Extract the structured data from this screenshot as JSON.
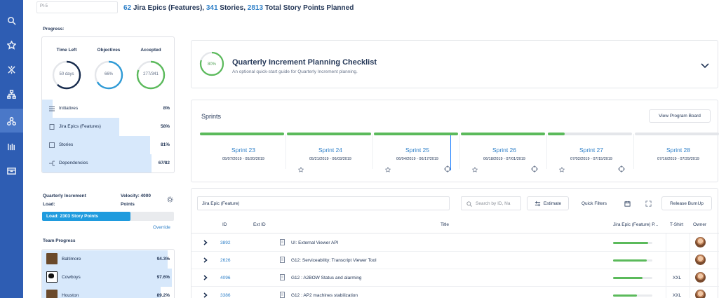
{
  "nav": {
    "icons": [
      "search-icon",
      "star-icon",
      "crosshair-icon",
      "hierarchy-icon",
      "program-icon",
      "roadmap-icon",
      "board-icon"
    ]
  },
  "header": {
    "pi_value": "PI-5",
    "epics_count": "62",
    "epics_label": " Jira Epics (Features), ",
    "stories_count": "341",
    "stories_label": " Stories, ",
    "points_count": "2813",
    "points_label": " Total Story Points Planned"
  },
  "progress": {
    "label": "Progress:",
    "metrics": [
      {
        "title": "Time Left",
        "value": "50 days",
        "fraction": 0.62,
        "color": "#172b4d"
      },
      {
        "title": "Objectives",
        "value": "66%",
        "fraction": 0.66,
        "color": "#2f9bd6"
      },
      {
        "title": "Accepted",
        "value": "277/341",
        "fraction": 0.81,
        "color": "#5bba5b"
      }
    ],
    "rows": [
      {
        "label": "Initiatives",
        "pct": "8%",
        "fraction": 0.08
      },
      {
        "label": "Jira Epics (Features)",
        "pct": "58%",
        "fraction": 0.58
      },
      {
        "label": "Stories",
        "pct": "81%",
        "fraction": 0.81
      },
      {
        "label": "Dependencies",
        "pct": "67/82",
        "fraction": 0.82
      }
    ]
  },
  "load": {
    "label": "Quarterly Increment Load:",
    "velocity": "Velocity: 4000 Points",
    "bar_text": "Load: 2303 Story Points",
    "fraction": 0.67,
    "override": "Override"
  },
  "team": {
    "label": "Team Progress",
    "rows": [
      {
        "name": "Baltimore",
        "pct": "94.3%",
        "fraction": 0.943
      },
      {
        "name": "Cowboys",
        "pct": "97.6%",
        "fraction": 0.976
      },
      {
        "name": "Houston",
        "pct": "89.2%",
        "fraction": 0.892
      }
    ]
  },
  "checklist": {
    "pct": "80%",
    "fraction": 0.8,
    "title": "Quarterly Increment Planning Checklist",
    "subtitle": "An optional quick-start guide for Quarterly Increment planning."
  },
  "sprints": {
    "title": "Sprints",
    "board_button": "View Program Board",
    "items": [
      {
        "name": "Sprint 23",
        "dates": "05/07/2019 - 05/20/2019",
        "fraction": 1.0,
        "has_target": false
      },
      {
        "name": "Sprint 24",
        "dates": "05/21/2019 - 06/03/2019",
        "fraction": 1.0,
        "has_target": false
      },
      {
        "name": "Sprint 25",
        "dates": "06/04/2019 - 06/17/2019",
        "fraction": 1.0,
        "has_target": true
      },
      {
        "name": "Sprint 26",
        "dates": "06/18/2019 - 07/01/2019",
        "fraction": 1.0,
        "has_target": true
      },
      {
        "name": "Sprint 27",
        "dates": "07/02/2019 - 07/15/2019",
        "fraction": 0.2,
        "has_target": true
      },
      {
        "name": "Sprint 28",
        "dates": "07/16/2019 - 07/29/2019",
        "fraction": 0.0,
        "has_target": false
      }
    ],
    "today_fraction": 0.48
  },
  "backlog": {
    "type_value": "Jira Epic (Feature)",
    "search_placeholder": "Search by ID, Na",
    "estimate_label": "Estimate",
    "quick_filters_label": "Quick Filters",
    "burnup_label": "Release BurnUp",
    "columns": {
      "id": "ID",
      "ext_id": "Ext ID",
      "title": "Title",
      "progress": "Jira Epic (Feature) P...",
      "tshirt": "T-Shirt",
      "owner": "Owner"
    },
    "rows": [
      {
        "id": "3892",
        "title": "UI: External Viewer API",
        "progress": 0.9,
        "tshirt": ""
      },
      {
        "id": "2626",
        "title": "G12: Serviceability: Transcript Viewer Tool",
        "progress": 0.85,
        "tshirt": ""
      },
      {
        "id": "4096",
        "title": "G12 : A2BOW Status and alarming",
        "progress": 0.75,
        "tshirt": "XXL"
      },
      {
        "id": "3386",
        "title": "G12 : AP2 machines stabilization",
        "progress": 0.6,
        "tshirt": "XXL"
      }
    ]
  }
}
